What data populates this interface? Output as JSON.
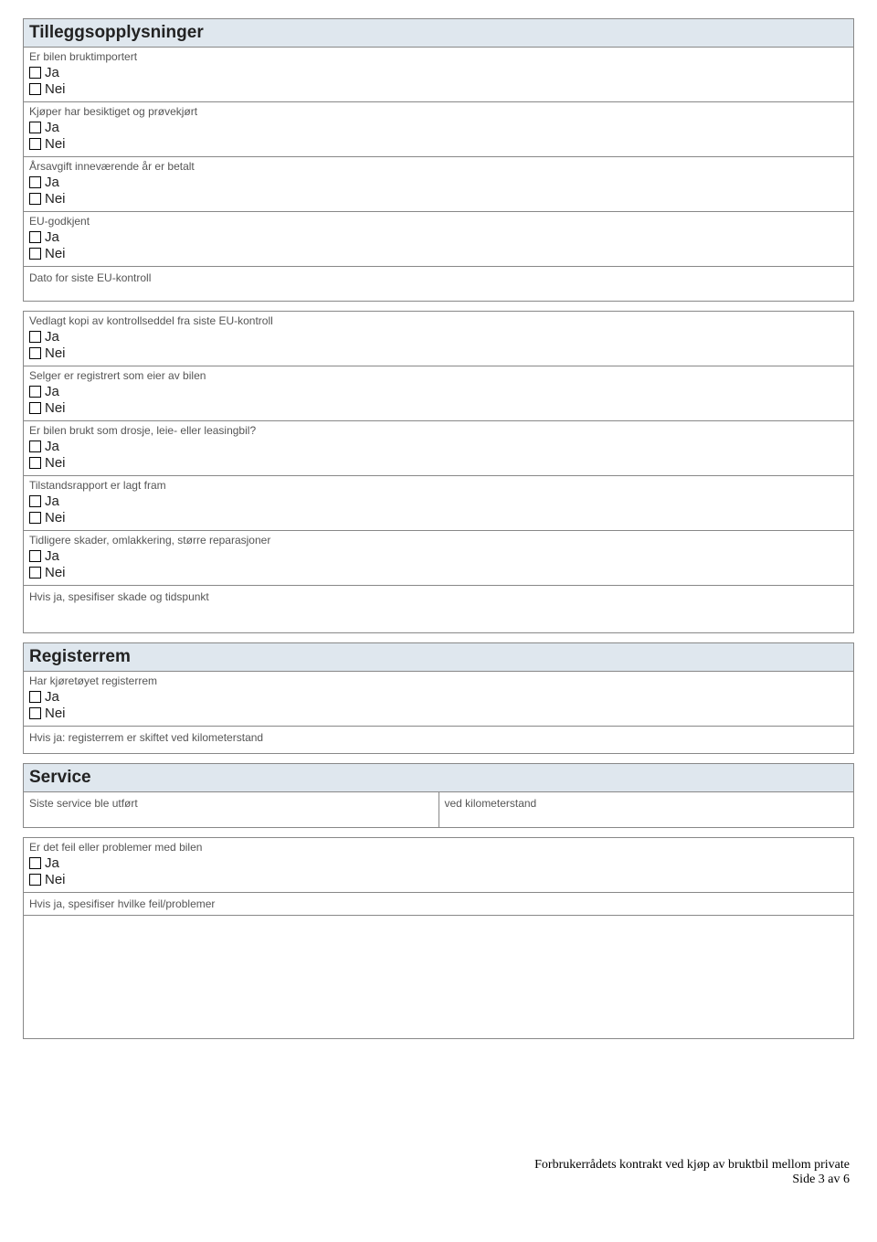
{
  "yesLabel": "Ja",
  "noLabel": "Nei",
  "section1": {
    "title": "Tilleggsopplysninger",
    "q1": "Er bilen bruktimportert",
    "q2": "Kjøper har besiktiget og prøvekjørt",
    "q3": "Årsavgift inneværende år er betalt",
    "q4": "EU-godkjent",
    "q5": "Dato for siste EU-kontroll",
    "q6": "Vedlagt kopi av kontrollseddel fra siste EU-kontroll",
    "q7": "Selger er registrert som eier av bilen",
    "q8": "Er bilen brukt som drosje, leie- eller leasingbil?",
    "q9": "Tilstandsrapport er lagt fram",
    "q10": "Tidligere skader, omlakkering, større reparasjoner",
    "q11": "Hvis ja, spesifiser skade og tidspunkt"
  },
  "section2": {
    "title": "Registerrem",
    "q1": "Har kjøretøyet registerrem",
    "q2": "Hvis ja: registerrem er skiftet ved kilometerstand"
  },
  "section3": {
    "title": "Service",
    "q1a": "Siste service ble utført",
    "q1b": "ved kilometerstand",
    "q2": "Er det feil eller problemer med bilen",
    "q3": "Hvis ja, spesifiser hvilke feil/problemer"
  },
  "footer": {
    "line1": "Forbrukerrådets kontrakt ved kjøp av bruktbil mellom private",
    "line2": "Side 3 av 6"
  }
}
